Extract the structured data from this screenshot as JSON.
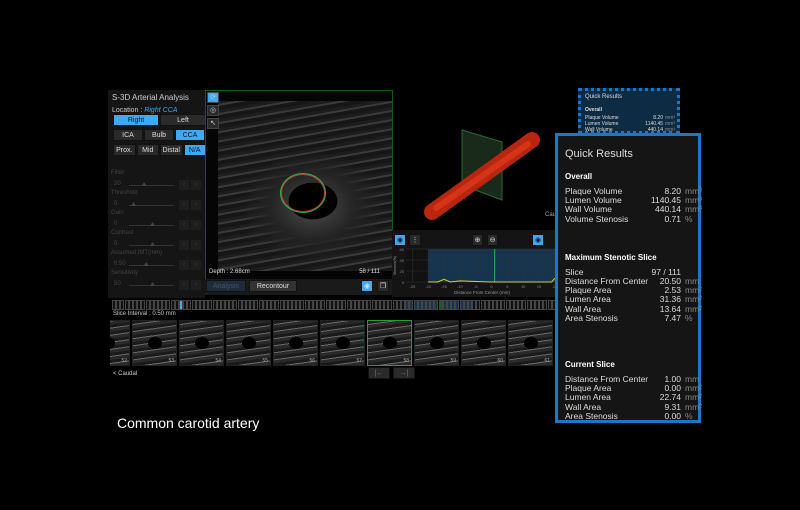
{
  "left_panel": {
    "title": "S-3D Arterial Analysis",
    "location_label": "Location : ",
    "location_value": "Right CCA",
    "side": [
      {
        "label": "Right",
        "active": true
      },
      {
        "label": "Left",
        "active": false
      }
    ],
    "segment": [
      {
        "label": "ICA",
        "active": false
      },
      {
        "label": "Bulb",
        "active": false
      },
      {
        "label": "CCA",
        "active": true
      }
    ],
    "position": [
      {
        "label": "Prox.",
        "active": false
      },
      {
        "label": "Mid",
        "active": false
      },
      {
        "label": "Distal",
        "active": false
      },
      {
        "label": "N/A",
        "active": true
      }
    ],
    "controls": [
      {
        "label": "Filter",
        "value": "20",
        "level": 0.3
      },
      {
        "label": "Threshold",
        "value": "0",
        "level": 0.05
      },
      {
        "label": "Gain",
        "value": "0",
        "level": 0.5
      },
      {
        "label": "Contrast",
        "value": "0",
        "level": 0.5
      },
      {
        "label": "Assumed IMT(mm)",
        "value": "0.50",
        "level": 0.35
      },
      {
        "label": "Sensitivity",
        "value": "50",
        "level": 0.5
      }
    ]
  },
  "image": {
    "depth": "Depth : 2.68cm",
    "slice": "58 / 111",
    "analysis_label": "Analysis",
    "recontour_label": "Recontour"
  },
  "three_d": {
    "label": "Cau"
  },
  "chart_data": {
    "type": "line",
    "xlabel": "Distance From Center (mm)",
    "ylabel": "Stenosis(%)",
    "x_ticks": [
      -25,
      -20,
      -15,
      -10,
      -5,
      0,
      5,
      10,
      15,
      20
    ],
    "y_ticks": [
      0,
      20,
      40,
      60
    ],
    "xlim": [
      -27,
      21
    ],
    "ylim": [
      0,
      60
    ],
    "current_x": 1.0,
    "series": [
      {
        "name": "stenosis",
        "x": [
          -20,
          -17,
          -15,
          -13,
          -10,
          -5,
          0,
          5,
          10,
          15,
          19,
          20
        ],
        "y": [
          0,
          0,
          5,
          0,
          2,
          1,
          0,
          0,
          0,
          0,
          0,
          7
        ]
      }
    ]
  },
  "slices": {
    "interval": "Slice Interval : 0.50 mm",
    "thumbs": [
      "52",
      "53",
      "54",
      "55",
      "56",
      "57",
      "58",
      "59",
      "60",
      "61"
    ],
    "selected": "58",
    "caudal": "< Caudal",
    "prev": "|←",
    "next": "→|"
  },
  "caption": "Common carotid artery",
  "quick_results": {
    "title": "Quick Results",
    "overall": {
      "heading": "Overall",
      "rows": [
        {
          "label": "Plaque Volume",
          "value": "8.20",
          "unit": "mm³"
        },
        {
          "label": "Lumen Volume",
          "value": "1140.45",
          "unit": "mm³"
        },
        {
          "label": "Wall Volume",
          "value": "440.14",
          "unit": "mm³"
        },
        {
          "label": "Volume Stenosis",
          "value": "0.71",
          "unit": "%"
        }
      ]
    },
    "max": {
      "heading": "Maximum Stenotic Slice",
      "rows": [
        {
          "label": "Slice",
          "value": "97 / 111",
          "unit": ""
        },
        {
          "label": "Distance From Center",
          "value": "20.50",
          "unit": "mm"
        },
        {
          "label": "Plaque Area",
          "value": "2.53",
          "unit": "mm²"
        },
        {
          "label": "Lumen Area",
          "value": "31.36",
          "unit": "mm²"
        },
        {
          "label": "Wall Area",
          "value": "13.64",
          "unit": "mm²"
        },
        {
          "label": "Area Stenosis",
          "value": "7.47",
          "unit": "%"
        }
      ]
    },
    "current": {
      "heading": "Current Slice",
      "rows": [
        {
          "label": "Distance From Center",
          "value": "1.00",
          "unit": "mm"
        },
        {
          "label": "Plaque Area",
          "value": "0.00",
          "unit": "mm²"
        },
        {
          "label": "Lumen Area",
          "value": "22.74",
          "unit": "mm²"
        },
        {
          "label": "Wall Area",
          "value": "9.31",
          "unit": "mm²"
        },
        {
          "label": "Area Stenosis",
          "value": "0.00",
          "unit": "%"
        }
      ]
    }
  }
}
